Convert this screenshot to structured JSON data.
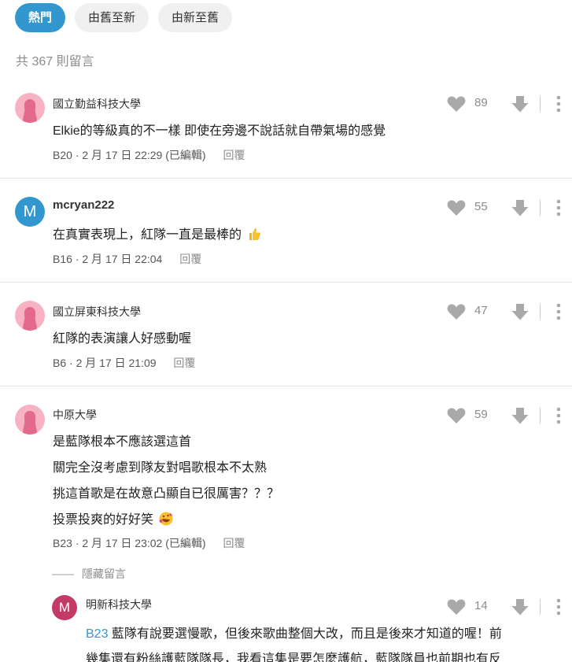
{
  "sort_tabs": [
    {
      "label": "熱門",
      "active": true
    },
    {
      "label": "由舊至新",
      "active": false
    },
    {
      "label": "由新至舊",
      "active": false
    }
  ],
  "comment_count": "共 367 則留言",
  "comments": [
    {
      "author": "國立勤益科技大學",
      "lines": [
        "Elkie的等級真的不一樣 即使在旁邊不說話就自帶氣場的感覺"
      ],
      "floor": "B20",
      "time": "2 月 17 日 22:29 (已編輯)",
      "likes": "89",
      "reply_label": "回覆"
    },
    {
      "author": "mcryan222",
      "avatar_letter": "M",
      "lines": [
        "在真實表現上，紅隊一直是最棒的"
      ],
      "emoji": "thumbs-up",
      "floor": "B16",
      "time": "2 月 17 日 22:04",
      "likes": "55",
      "reply_label": "回覆"
    },
    {
      "author": "國立屏東科技大學",
      "lines": [
        "紅隊的表演讓人好感動喔"
      ],
      "floor": "B6",
      "time": "2 月 17 日 21:09",
      "likes": "47",
      "reply_label": "回覆"
    },
    {
      "author": "中原大學",
      "lines": [
        "是藍隊根本不應該選這首",
        "關完全沒考慮到隊友對唱歌根本不太熟",
        "挑這首歌是在故意凸顯自已很厲害？？？",
        "投票投爽的好好笑"
      ],
      "emoji": "rolling-laughing",
      "floor": "B23",
      "time": "2 月 17 日 23:02 (已編輯)",
      "likes": "59",
      "reply_label": "回覆"
    }
  ],
  "hidden_toggle": "隱藏留言",
  "reply": {
    "author": "明新科技大學",
    "avatar_letter": "M",
    "floor_ref": "B23",
    "line1": "藍隊有說要選慢歌，但後來歌曲整個大改，而且是後來才知道的喔！前",
    "line2": "幾集還有粉絲護藍隊隊長，我看這集是要怎麼護航，藍隊隊員也前期也有反",
    "likes": "14"
  },
  "colors": {
    "accent": "#3397cf",
    "avatar_pink": "#f7b3c4",
    "silhouette": "#e36a8a",
    "reply_avatar": "#c43a66",
    "icon_gray": "#a9a9a9"
  }
}
